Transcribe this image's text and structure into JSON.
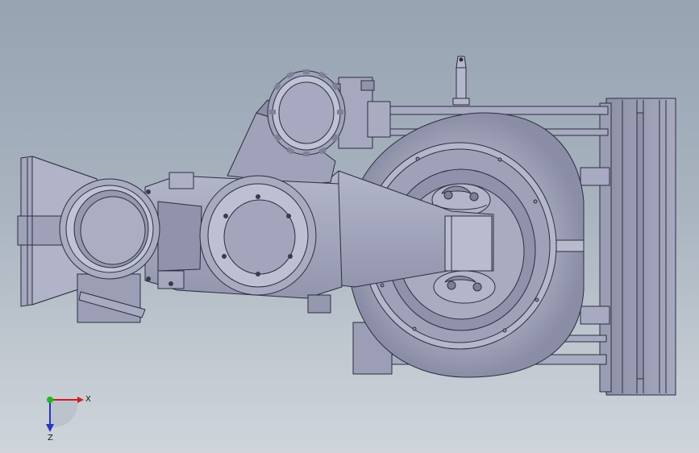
{
  "viewport": {
    "background_top": "#96a3b1",
    "background_bottom": "#cfd5db",
    "model_fill": "#a4a7bd",
    "model_shadow": "#7e8199",
    "model_highlight": "#c3c6d8",
    "edge_color": "#2c2e3e"
  },
  "triad": {
    "x_label": "X",
    "z_label": "Z",
    "x_color": "#d21e1e",
    "y_color": "#1fb81f",
    "z_color": "#2437c8"
  }
}
